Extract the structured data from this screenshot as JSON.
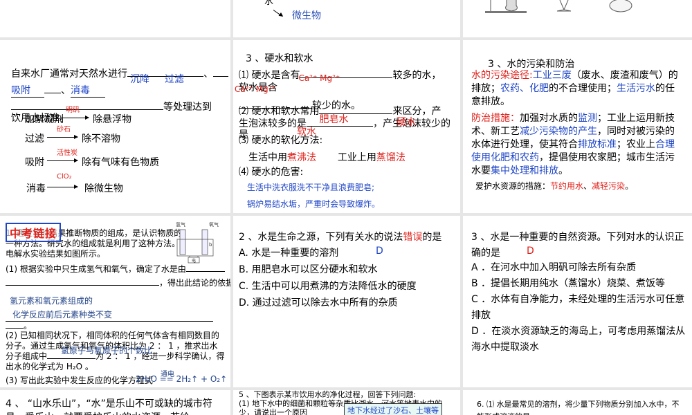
{
  "s1": {
    "microbe": "微生物",
    "water_char": "水"
  },
  "s4": {
    "intro": "自来水厂通常对天然水进行",
    "a1": "沉降",
    "a2": "过滤",
    "a3": "吸附",
    "a4": "消毒",
    "tail": "等处理达到",
    "tail2": "饮用水标准。",
    "rows": [
      {
        "label": "加絮凝剂",
        "reagent": "明矾",
        "result": "除悬浮物"
      },
      {
        "label": "过滤",
        "reagent": "砂石",
        "result": "除不溶物"
      },
      {
        "label": "吸附",
        "reagent": "活性炭",
        "result": "除有气味有色物质"
      },
      {
        "label": "消毒",
        "reagent": "ClO₂",
        "result": "除微生物"
      }
    ]
  },
  "s5": {
    "title": "3 、硬水和软水",
    "l1a": "⑴ 硬水是含有",
    "l1fill": "Ca²⁺ Mg²⁺",
    "l1b": "较多的水，",
    "l2": "软水是含",
    "l2fill": "Ca²⁺ Mg²⁺",
    "l2b": "较少的水。",
    "l3a": "⑵ 硬水和软水常用",
    "l3fill": "肥皂水",
    "l3b": "来区分，产",
    "l4a": "生泡沫较多的是",
    "l4fill1": "软水",
    "l4b": "，产生泡沫较少的",
    "l4fill2": "硬水",
    "l5": "是",
    "l6": "⑶ 硬水的软化方法:",
    "l7a": "生活中用",
    "l7fill": "煮沸法",
    "l7b": "工业上用",
    "l7fill2": "蒸馏法",
    "l8": "⑷ 硬水的危害:",
    "h1": "生活中洗衣服洗不干净且浪费肥皂;",
    "h2": "锅炉易结水垢，严重时会导致爆炸。"
  },
  "s6": {
    "title": "3 、水的污染和防治",
    "p1": [
      {
        "t": "水的污染途径:",
        "c": "red"
      },
      {
        "t": "工业三废",
        "c": "blue"
      },
      {
        "t": "（废水、废渣和废气）的排放；",
        "c": ""
      },
      {
        "t": "农药、化肥",
        "c": "blue"
      },
      {
        "t": "的不合理使用；",
        "c": ""
      },
      {
        "t": "生活污水",
        "c": "blue"
      },
      {
        "t": "的任意排放。",
        "c": ""
      }
    ],
    "p2": [
      {
        "t": "防治措施：",
        "c": "red"
      },
      {
        "t": "加强对水质的",
        "c": ""
      },
      {
        "t": "监测",
        "c": "blue"
      },
      {
        "t": "；工业上运用新技术、新工艺",
        "c": ""
      },
      {
        "t": "减少污染物的产生",
        "c": "blue"
      },
      {
        "t": "，同时对被污染的水体进行处理，使其符合",
        "c": ""
      },
      {
        "t": "排放标准",
        "c": "blue"
      },
      {
        "t": "；农业上",
        "c": ""
      },
      {
        "t": "合理使用化肥和农药",
        "c": "blue"
      },
      {
        "t": "，提倡使用农家肥；城市生活污水要",
        "c": ""
      },
      {
        "t": "集中处理和排放",
        "c": "blue"
      },
      {
        "t": "。",
        "c": ""
      }
    ],
    "p3": [
      {
        "t": "爱护水资源的措施：",
        "c": ""
      },
      {
        "t": "节约用水",
        "c": "red"
      },
      {
        "t": "、",
        "c": ""
      },
      {
        "t": "减轻污染",
        "c": "red"
      },
      {
        "t": "。",
        "c": ""
      }
    ]
  },
  "s7": {
    "tag": "中考链接",
    "q": "1. 通过实验结果推断物质的组成，是认识物质的一种方法。研究水的组成就是利用了这种方法。电解水实验结果如图所示。",
    "q1": "(1) 根据实验中只生成氢气和氧气，确定了水是由",
    "q1b": "，得出此结论的依据是",
    "a1": "氢元素和氧元素组成的",
    "a1b": "化学反应前后元素种类不变",
    "q2": "(2) 已知相同状况下，相同体积的任何气体含有相同数目的分子。通过生成氢气和氧气的体积比为 2 ： 1 ，推求出水分子组成中",
    "a2": "氢原子与氧原子的个数比",
    "q2b": "为 2 ： 1 ，经进一步科学确认，得出水的化学式为 H₂O 。",
    "q3": "(3) 写出此实验中发生反应的化学方程式",
    "eq": "2H₂O == 2H₂↑ + O₂↑",
    "eq_cond": "通电",
    "fig_h2": "氢气",
    "fig_o2": "氧气",
    "fig_power": "电",
    "fig_b": "b",
    "fig_code": "i 13"
  },
  "s8": {
    "q": "2 、水是生命之源，下列有关水的说法",
    "q_red": "错误",
    "q_end": "的是",
    "ans": "D",
    "options": [
      "A. 水是一种重要的溶剂",
      "B. 用肥皂水可以区分硬水和软水",
      "C. 生活中可以用煮沸的方法降低水的硬度",
      "D. 通过过滤可以除去水中所有的杂质"
    ]
  },
  "s9": {
    "q": "3 、水是一种重要的自然资源。下列对水的认识正确的是",
    "ans": "D",
    "options": [
      "A ．在河水中加入明矾可除去所有杂质",
      "B ．提倡长期用纯水（蒸馏水）烧菜、煮饭等",
      "C ．水体有自净能力，未经处理的生活污水可任意排放",
      "D ．在淡水资源缺乏的海岛上，可考虑用蒸馏法从海水中提取淡水"
    ]
  },
  "s10": {
    "text": "4 、 “山水乐山”，“水”是乐山不可或缺的城市符号，爱乐山，就要爱护乐山的水资源。若给"
  },
  "s11": {
    "t1": "5 、下图表示某市饮用水的净化过程，回答下列问题:",
    "t2": "(1) 地下水中的细菌和颗粒等杂质比湖水、河水等地表水中的少，请说出一个原因",
    "box": "地下水经过了沙石、土壤等"
  },
  "s12": {
    "text": "6. ⑴ 水是最常见的溶剂，将少量下列物质分别加入水中，不能形成溶液的是"
  }
}
